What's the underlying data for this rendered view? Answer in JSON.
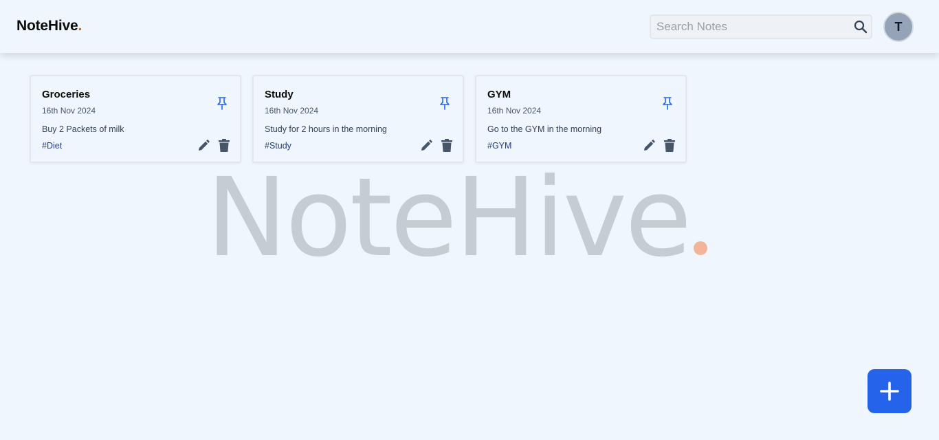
{
  "app": {
    "brand": "NoteHive",
    "brand_dot": ".",
    "accent_color": "#ea580c"
  },
  "search": {
    "placeholder": "Search Notes",
    "value": ""
  },
  "user": {
    "initial": "T"
  },
  "watermark": {
    "text": "NoteHive"
  },
  "notes": [
    {
      "title": "Groceries",
      "date": "16th Nov 2024",
      "content": "Buy 2 Packets of milk",
      "tag": "#Diet",
      "pinned": false
    },
    {
      "title": "Study",
      "date": "16th Nov 2024",
      "content": "Study for 2 hours in the morning",
      "tag": "#Study",
      "pinned": false
    },
    {
      "title": "GYM",
      "date": "16th Nov 2024",
      "content": "Go to the GYM in the morning",
      "tag": "#GYM",
      "pinned": false
    }
  ],
  "icons": {
    "search": "search-icon",
    "pin": "pin-icon",
    "edit": "pencil-icon",
    "delete": "trash-icon",
    "add": "plus-icon"
  },
  "colors": {
    "primary": "#2563eb",
    "background": "#eff6fd",
    "watermark": "#c6ccd4",
    "watermark_dot": "#f1b597"
  }
}
